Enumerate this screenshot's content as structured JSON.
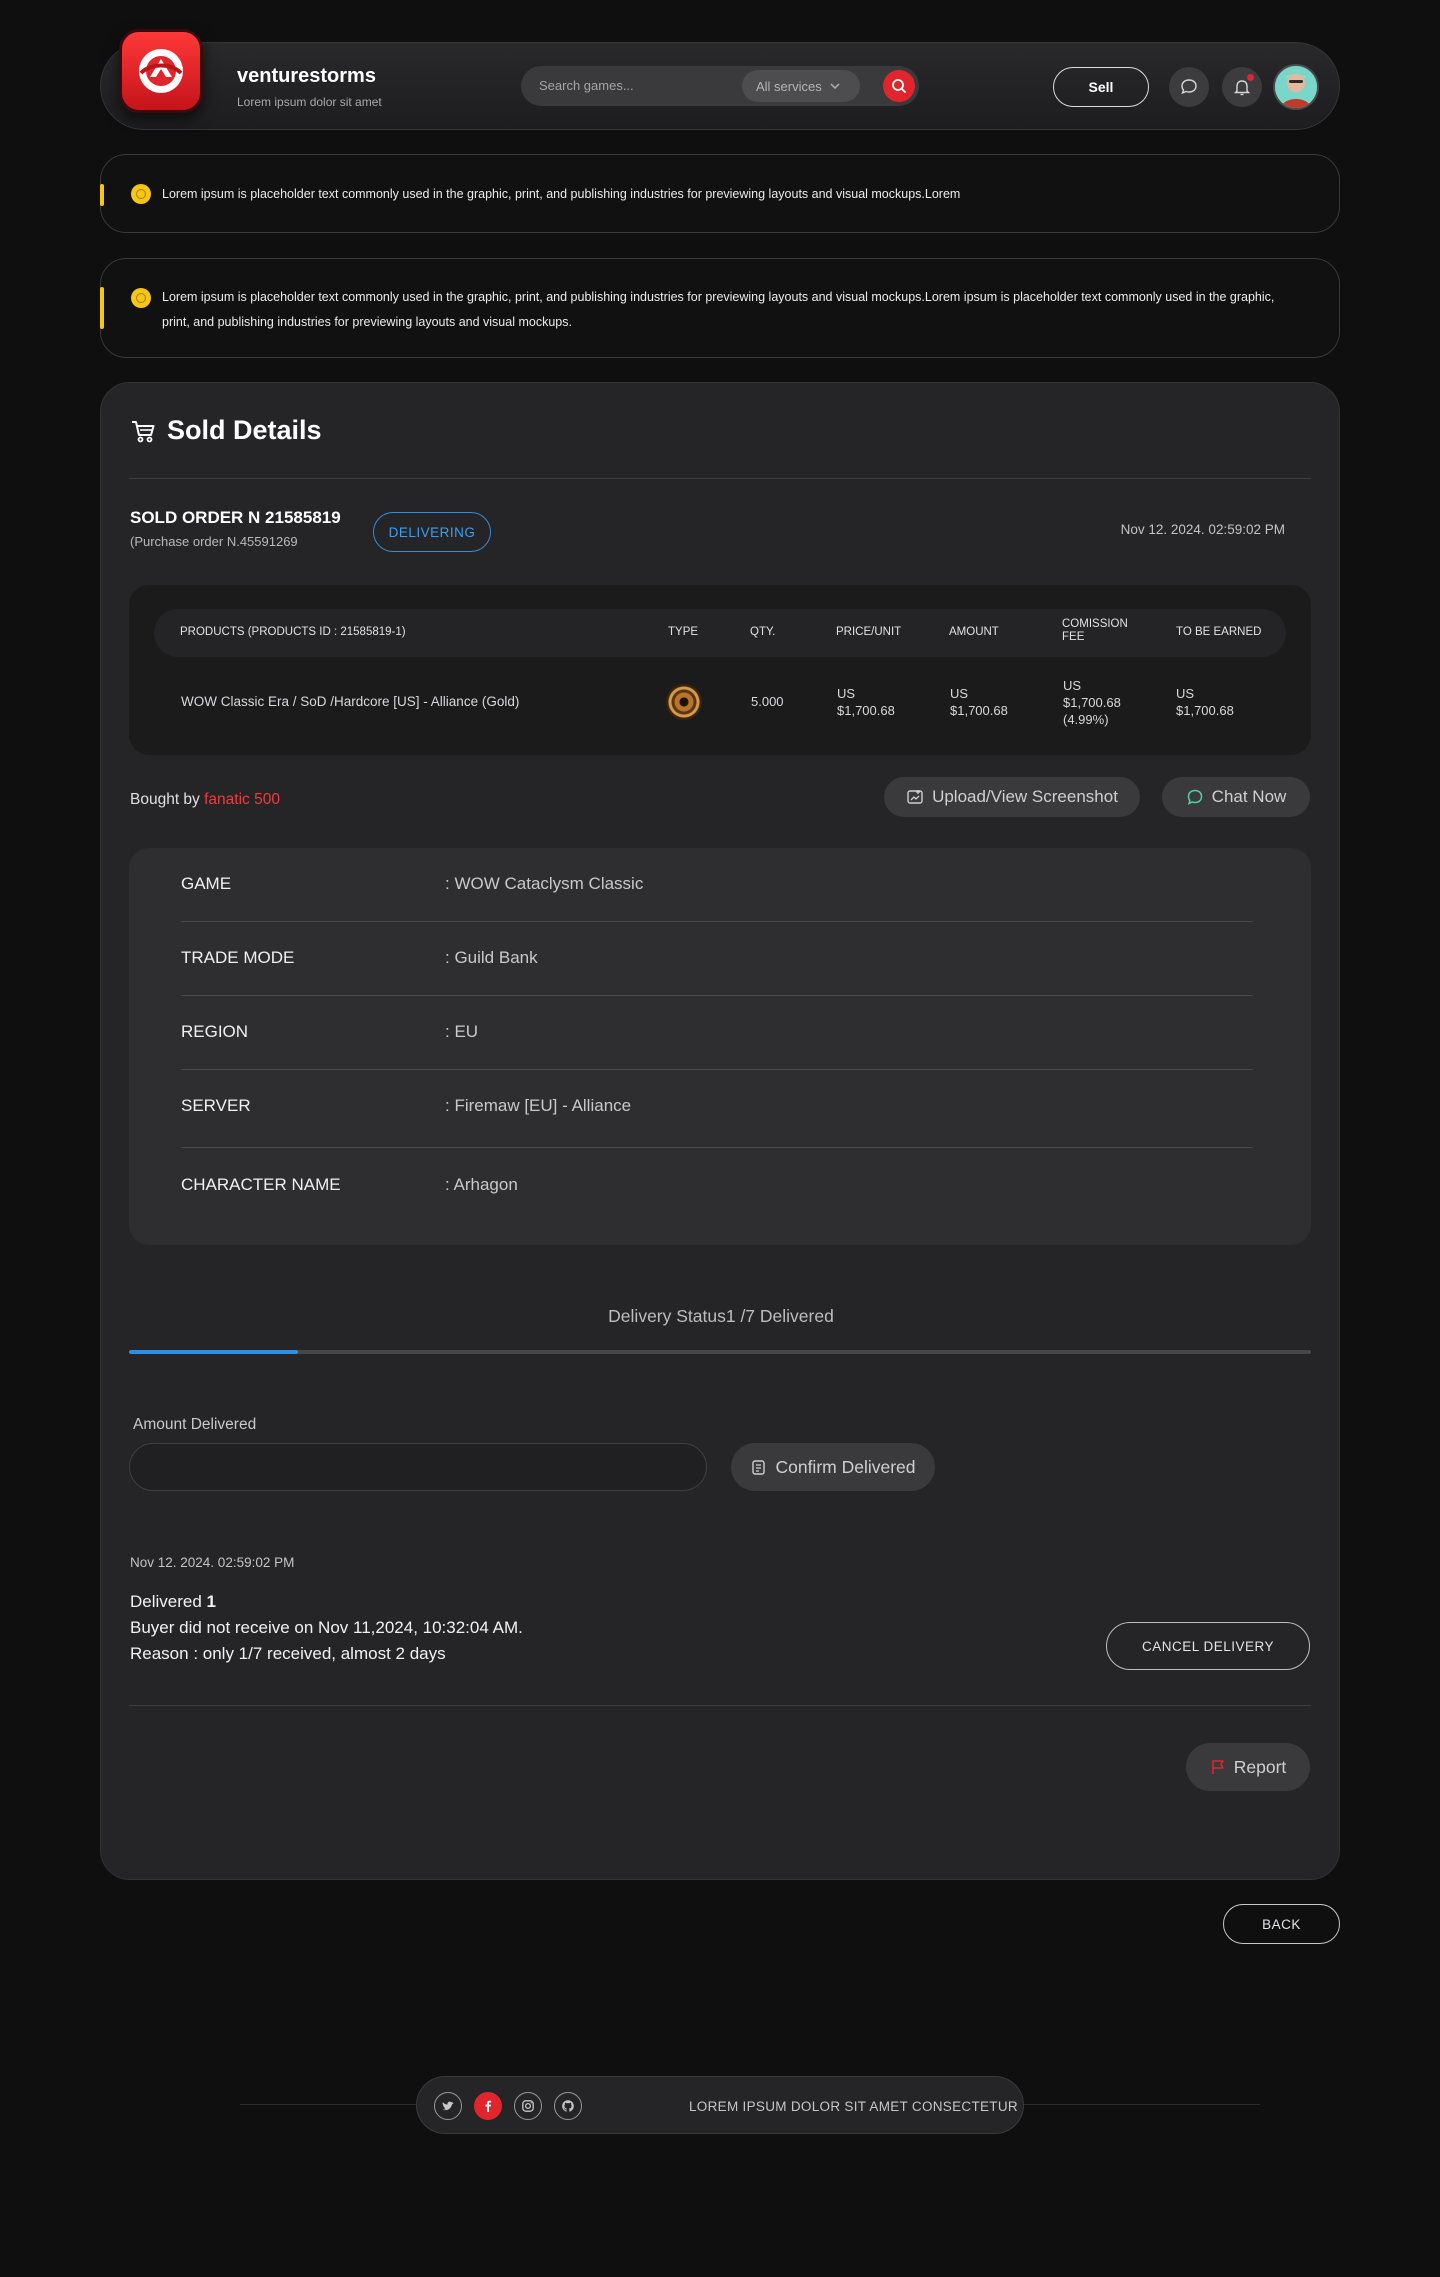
{
  "brand": {
    "name": "venturestorms",
    "tagline": "Lorem ipsum dolor sit amet"
  },
  "search": {
    "placeholder": "Search games...",
    "service_filter": "All services"
  },
  "header": {
    "sell_label": "Sell"
  },
  "notices": [
    {
      "text": "Lorem ipsum is placeholder text commonly used in the graphic, print, and publishing industries for previewing layouts and visual mockups.Lorem"
    },
    {
      "text": "Lorem ipsum is placeholder text commonly used in the graphic, print, and publishing industries for previewing layouts and visual mockups.Lorem ipsum is placeholder text commonly used in the graphic, print, and publishing industries for previewing layouts and visual mockups."
    }
  ],
  "sold": {
    "title": "Sold Details",
    "order_number": "SOLD ORDER N 21585819",
    "purchase_order": "(Purchase order N.45591269",
    "status": "DELIVERING",
    "date": "Nov 12. 2024.  02:59:02  PM"
  },
  "products": {
    "headers": {
      "product": "PRODUCTS (PRODUCTS  ID : 21585819-1)",
      "type": "TYPE",
      "qty": "QTY.",
      "price": "PRICE/UNIT",
      "amount": "AMOUNT",
      "fee_line1": "COMISSION",
      "fee_line2": "FEE",
      "earned": "TO BE EARNED"
    },
    "row": {
      "name": "WOW Classic Era / SoD /Hardcore [US] - Alliance (Gold)",
      "type_icon": "gold-coin-icon",
      "qty": "5.000",
      "price_cur": "US",
      "price_val": "$1,700.68",
      "amount_cur": "US",
      "amount_val": "$1,700.68",
      "fee_cur": "US",
      "fee_val": "$1,700.68",
      "fee_pct": "(4.99%)",
      "earned_cur": "US",
      "earned_val": "$1,700.68"
    }
  },
  "buyer": {
    "prefix": "Bought by",
    "name": "fanatic 500"
  },
  "actions": {
    "upload": "Upload/View Screenshot",
    "chat": "Chat Now"
  },
  "details": [
    {
      "key": "GAME",
      "value": ": WOW Cataclysm Classic"
    },
    {
      "key": "TRADE MODE",
      "value": ": Guild Bank"
    },
    {
      "key": "REGION",
      "value": ": EU"
    },
    {
      "key": "SERVER",
      "value": ": Firemaw [EU] - Alliance"
    },
    {
      "key": "CHARACTER NAME",
      "value": ": Arhagon"
    }
  ],
  "delivery": {
    "status_label": "Delivery Status1 /7 Delivered",
    "delivered": 1,
    "total": 7,
    "amount_label": "Amount Delivered",
    "amount_value": "",
    "confirm_label": "Confirm Delivered",
    "log_date": "Nov 12. 2024.  02:59:02  PM",
    "delivered_prefix": "Delivered ",
    "delivered_count": "1",
    "message": "Buyer did not receive on Nov 11,2024, 10:32:04 AM.",
    "reason": "Reason : only 1/7 received, almost 2 days",
    "cancel_label": "CANCEL DELIVERY",
    "report_label": "Report"
  },
  "back_label": "BACK",
  "footer": {
    "text": "LOREM IPSUM DOLOR SIT AMET CONSECTETUR"
  },
  "colors": {
    "accent_red": "#e0262c",
    "accent_blue": "#2d8fe4",
    "notice_yellow": "#f5c518"
  }
}
